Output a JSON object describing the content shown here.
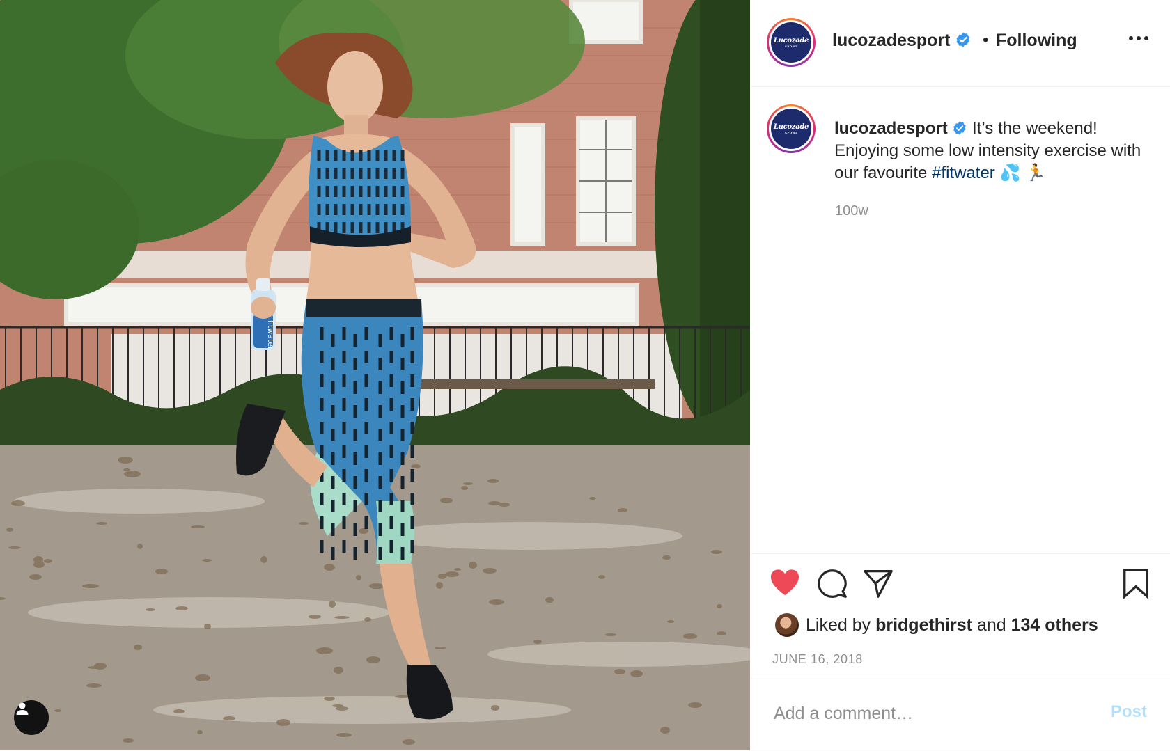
{
  "account": {
    "username": "lucozadesport",
    "follow_status": "Following",
    "avatar_logo_line1": "Lucozade",
    "avatar_logo_line2": "SPORT"
  },
  "caption": {
    "username": "lucozadesport",
    "text": "It’s the weekend! Enjoying some low intensity exercise with our favourite",
    "hashtag": "#fitwater",
    "emoji": "💦 🏃",
    "time_ago": "100w"
  },
  "photo": {
    "bottle_label": "fitwater"
  },
  "likes": {
    "prefix": "Liked by",
    "user": "bridgethirst",
    "connector": "and",
    "others": "134 others"
  },
  "date": "JUNE 16, 2018",
  "comment": {
    "placeholder": "Add a comment…",
    "post_label": "Post"
  },
  "icons": {
    "like": "heart-icon",
    "comment": "comment-icon",
    "share": "send-icon",
    "save": "bookmark-icon",
    "more": "more-options-icon",
    "tagged": "user-tag-icon",
    "verified": "verified-badge-icon"
  },
  "colors": {
    "like_active": "#ed4956",
    "verified": "#3897f0",
    "hashtag": "#00376b",
    "post_button_disabled": "#b2dffc"
  }
}
